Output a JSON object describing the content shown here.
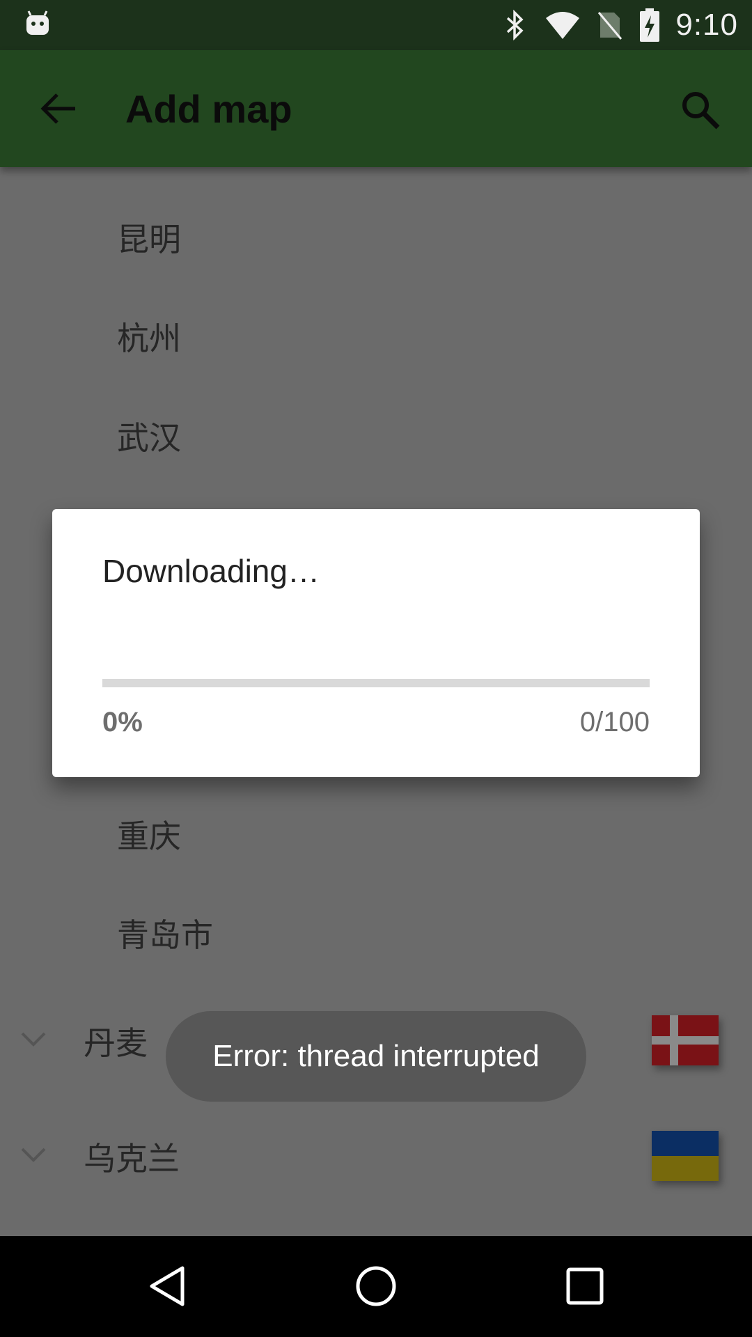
{
  "status_bar": {
    "time": "9:10",
    "icons": [
      "android-icon",
      "bluetooth-icon",
      "wifi-icon",
      "no-sim-icon",
      "battery-charging-icon"
    ]
  },
  "app_bar": {
    "title": "Add map",
    "back_icon": "arrow-back-icon",
    "search_icon": "search-icon"
  },
  "list": {
    "cities": [
      "昆明",
      "杭州",
      "武汉",
      "重庆",
      "青岛市"
    ],
    "countries": [
      {
        "name": "丹麦",
        "flag": "denmark-flag"
      },
      {
        "name": "乌克兰",
        "flag": "ukraine-flag"
      }
    ]
  },
  "dialog": {
    "title": "Downloading…",
    "percent_label": "0%",
    "count_label": "0/100",
    "progress": 0.0
  },
  "toast": {
    "message": "Error: thread interrupted"
  },
  "nav_bar": {
    "icons": [
      "back-icon",
      "home-icon",
      "recents-icon"
    ]
  },
  "colors": {
    "status_bar": "#1c321b",
    "app_bar": "#22471f",
    "scrim_background": "#6b6b6b",
    "toast": "#575757",
    "progress_track": "#d9d9d9"
  }
}
